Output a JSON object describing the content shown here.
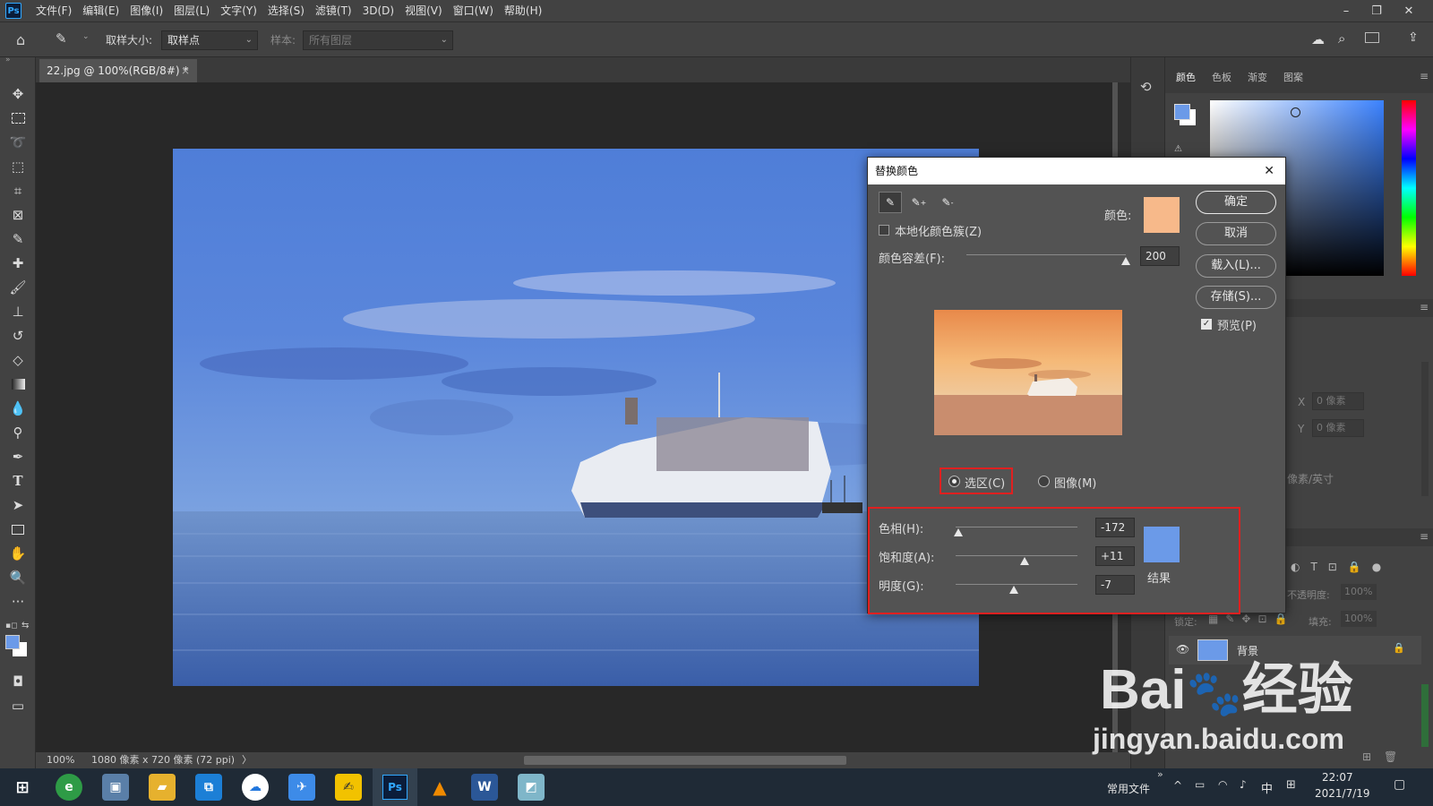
{
  "menubar": {
    "app_logo": "Ps",
    "items": [
      "文件(F)",
      "编辑(E)",
      "图像(I)",
      "图层(L)",
      "文字(Y)",
      "选择(S)",
      "滤镜(T)",
      "3D(D)",
      "视图(V)",
      "窗口(W)",
      "帮助(H)"
    ]
  },
  "options": {
    "sample_size_label": "取样大小:",
    "sample_size_value": "取样点",
    "sample_label": "样本:",
    "sample_value": "所有图层"
  },
  "document": {
    "tab_title": "22.jpg @ 100%(RGB/8#) *",
    "tab_close": "×"
  },
  "status": {
    "zoom": "100%",
    "info": "1080 像素 x 720 像素 (72 ppi)",
    "arrow": "〉"
  },
  "color_panel": {
    "tabs": [
      "颜色",
      "色板",
      "渐变",
      "图案"
    ],
    "colors": {
      "foreground": "#6b9ae8",
      "background": "#ffffff"
    }
  },
  "properties_panel": {
    "x_label": "X",
    "x_value": "0 像素",
    "y_label": "Y",
    "y_value": "0 像素",
    "resolution": "像素/英寸"
  },
  "layers_panel": {
    "opacity_label": "不透明度:",
    "opacity_value": "100%",
    "lock_label": "锁定:",
    "fill_label": "填充:",
    "fill_value": "100%",
    "layer_name": "背景"
  },
  "dialog": {
    "title": "替换颜色",
    "color_label": "颜色:",
    "sample_color": "#f7b98a",
    "localized_label": "本地化颜色簇(Z)",
    "localized_checked": false,
    "fuzziness_label": "颜色容差(F):",
    "fuzziness_value": "200",
    "fuzziness_fraction": 1.0,
    "buttons": {
      "ok": "确定",
      "cancel": "取消",
      "load": "载入(L)...",
      "save": "存储(S)..."
    },
    "preview_label": "预览(P)",
    "preview_checked": true,
    "selection_label": "选区(C)",
    "image_label": "图像(M)",
    "selected_mode": "selection",
    "hue_label": "色相(H):",
    "hue_value": "-172",
    "saturation_label": "饱和度(A):",
    "saturation_value": "+11",
    "lightness_label": "明度(G):",
    "lightness_value": "-7",
    "result_label": "结果",
    "result_color": "#6b9ae8"
  },
  "taskbar": {
    "folder_label": "常用文件",
    "ime": "中",
    "time": "22:07",
    "date": "2021/7/19"
  },
  "watermark": {
    "brand_a": "Bai",
    "brand_b": "经验",
    "url": "jingyan.baidu.com"
  }
}
